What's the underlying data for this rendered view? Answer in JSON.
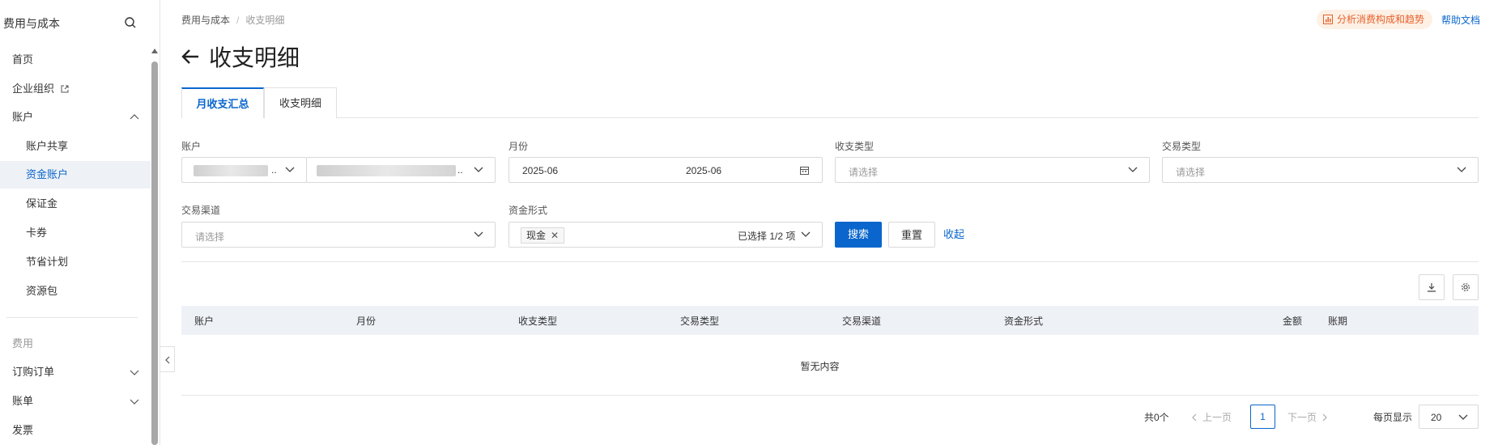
{
  "sidebar": {
    "title": "费用与成本",
    "items": {
      "home": "首页",
      "org": "企业组织",
      "account": "账户",
      "account_share": "账户共享",
      "fund_account": "资金账户",
      "deposit": "保证金",
      "coupon": "卡券",
      "saving_plan": "节省计划",
      "resource_pack": "资源包",
      "cost_section": "费用",
      "orders": "订购订单",
      "bills": "账单",
      "invoice": "发票"
    }
  },
  "breadcrumb": {
    "root": "费用与成本",
    "sep": "/",
    "current": "收支明细"
  },
  "header": {
    "analyze": "分析消费构成和趋势",
    "help": "帮助文档",
    "title": "收支明细"
  },
  "tabs": {
    "monthly": "月收支汇总",
    "detail": "收支明细"
  },
  "filters": {
    "account_label": "账户",
    "account_ellipsis1": "..",
    "account_ellipsis2": "..",
    "month_label": "月份",
    "month_start": "2025-06",
    "month_end": "2025-06",
    "type_label": "收支类型",
    "type_placeholder": "请选择",
    "trade_label": "交易类型",
    "trade_placeholder": "请选择",
    "channel_label": "交易渠道",
    "channel_placeholder": "请选择",
    "fund_label": "资金形式",
    "fund_tag": "现金",
    "fund_selected": "已选择 1/2 项",
    "search": "搜索",
    "reset": "重置",
    "collapse": "收起"
  },
  "table": {
    "columns": [
      "账户",
      "月份",
      "收支类型",
      "交易类型",
      "交易渠道",
      "资金形式",
      "金额",
      "账期"
    ],
    "empty": "暂无内容"
  },
  "pagination": {
    "total": "共0个",
    "prev": "上一页",
    "page": "1",
    "next": "下一页",
    "per_page_label": "每页显示",
    "per_page": "20"
  },
  "colors": {
    "accent": "#0a66cc",
    "analyze": "#e8612b"
  }
}
